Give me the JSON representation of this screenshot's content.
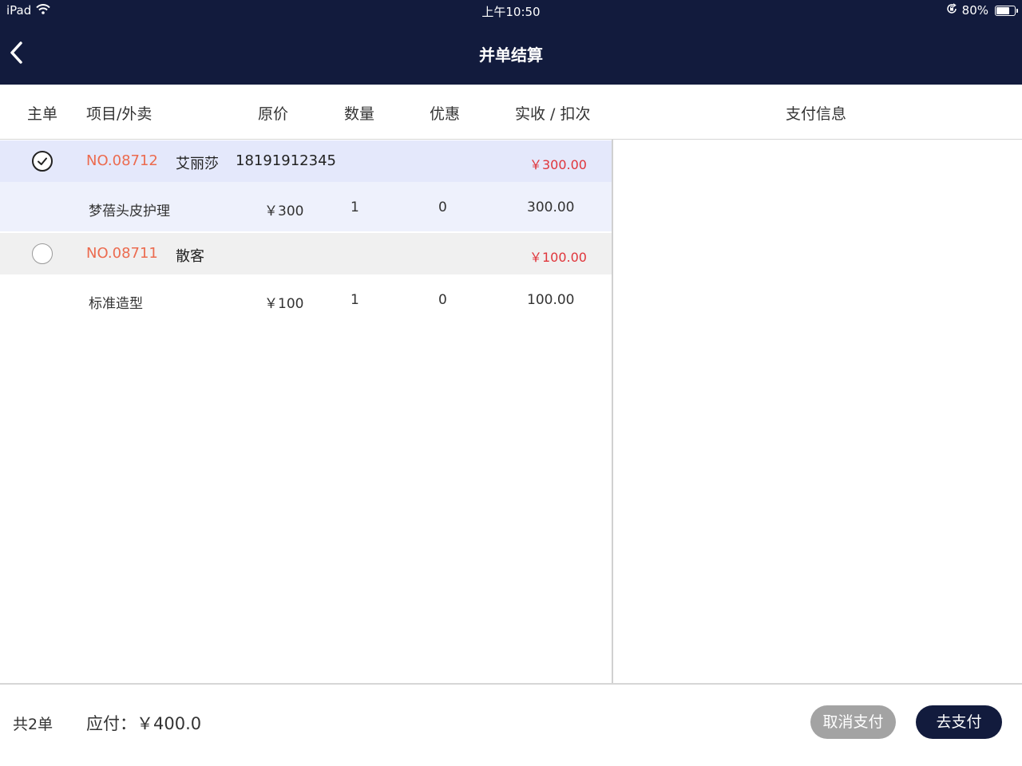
{
  "status_bar": {
    "device": "iPad",
    "time": "上午10:50",
    "battery": "80%",
    "battery_level": 0.8
  },
  "header": {
    "title": "并单结算"
  },
  "columns": {
    "main_order": "主单",
    "item": "项目/外卖",
    "price": "原价",
    "qty": "数量",
    "discount": "优惠",
    "received": "实收 / 扣次",
    "payment_info": "支付信息"
  },
  "orders": [
    {
      "number": "NO.08712",
      "customer": "艾丽莎",
      "phone": "18191912345",
      "total": "￥300.00",
      "selected": true,
      "item": {
        "name": "梦蓓头皮护理",
        "price": "￥300",
        "qty": "1",
        "discount": "0",
        "received": "300.00"
      }
    },
    {
      "number": "NO.08711",
      "customer": "散客",
      "phone": "",
      "total": "￥100.00",
      "selected": false,
      "item": {
        "name": "标准造型",
        "price": "￥100",
        "qty": "1",
        "discount": "0",
        "received": "100.00"
      }
    }
  ],
  "footer": {
    "count": "共2单",
    "payable": "应付：￥400.0",
    "cancel_button": "取消支付",
    "pay_button": "去支付"
  },
  "colors": {
    "nav_bg": "#121b3d",
    "order_no": "#ec6b4f",
    "total": "#e0353b",
    "selected_order_bg": "#e4e8fb",
    "selected_item_bg": "#eef1fc",
    "unselected_order_bg": "#f0f0f0",
    "cancel_button": "#a3a3a3"
  },
  "icons": {
    "back": "chevron-left-icon",
    "wifi": "wifi-icon",
    "lock": "rotation-lock-icon",
    "battery": "battery-icon",
    "check": "checkmark-icon"
  }
}
